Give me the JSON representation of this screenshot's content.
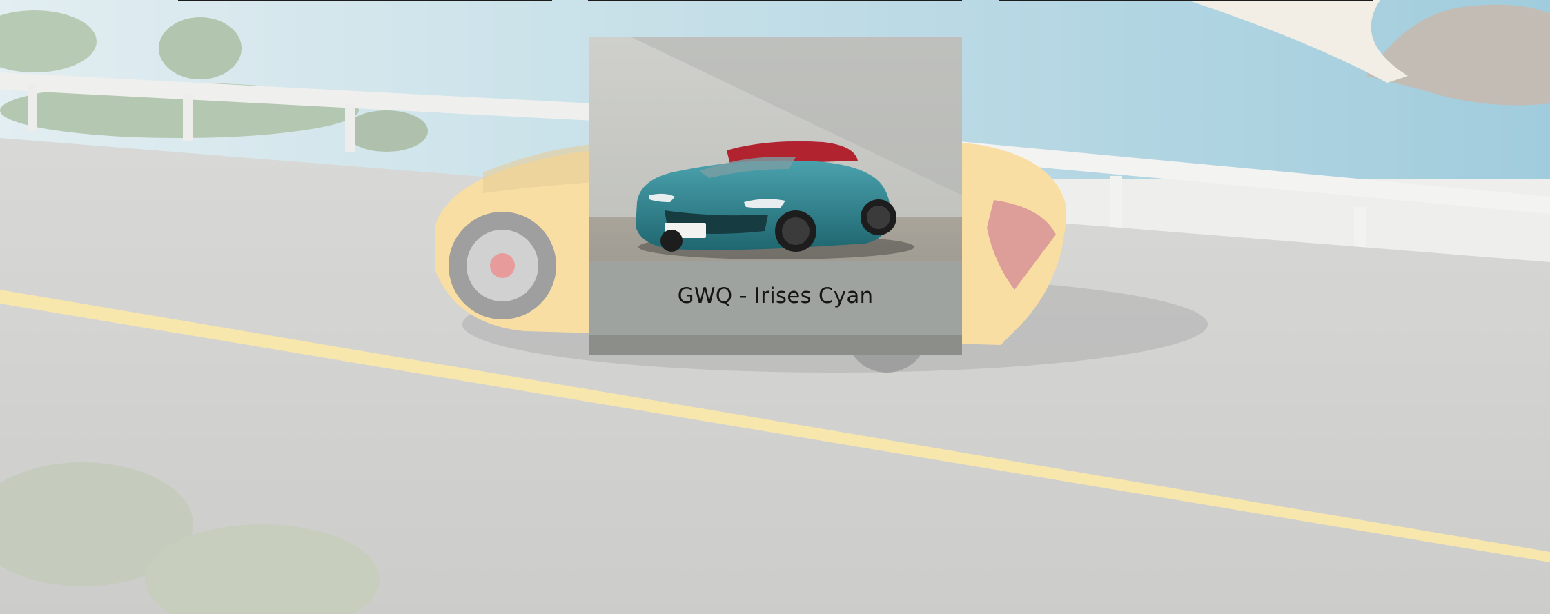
{
  "color_cards": [
    {
      "caption": "GWQ - Irises Cyan"
    }
  ],
  "colors": {
    "body_paint": "#2f7f8a",
    "soft_top": "#b0232f",
    "background_car": "#f2b633",
    "road_line": "#f0c94a",
    "divider": "#1c1c1c"
  }
}
